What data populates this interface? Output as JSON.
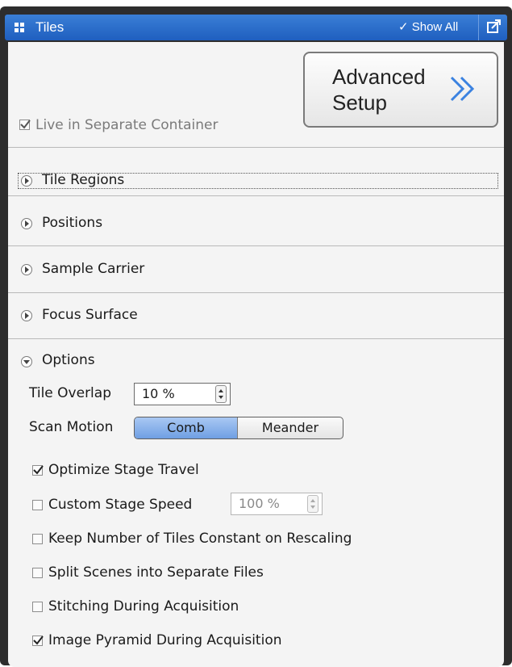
{
  "window": {
    "title": "Tiles",
    "show_all_label": "✓ Show All"
  },
  "advanced_setup": {
    "line1": "Advanced",
    "line2": "Setup"
  },
  "live_separate": {
    "label": "Live in Separate Container",
    "checked": true
  },
  "sections": [
    {
      "label": "Tile Regions",
      "expanded": false,
      "focused": true
    },
    {
      "label": "Positions",
      "expanded": false
    },
    {
      "label": "Sample Carrier",
      "expanded": false
    },
    {
      "label": "Focus Surface",
      "expanded": false
    },
    {
      "label": "Options",
      "expanded": true
    }
  ],
  "options": {
    "tile_overlap": {
      "label": "Tile Overlap",
      "value": "10 %"
    },
    "scan_motion": {
      "label": "Scan Motion",
      "choices": [
        "Comb",
        "Meander"
      ],
      "selected": "Comb"
    },
    "checkboxes": [
      {
        "label": "Optimize Stage Travel",
        "checked": true
      },
      {
        "label": "Custom Stage Speed",
        "checked": false,
        "speed_value": "100 %"
      },
      {
        "label": "Keep Number of Tiles Constant on Rescaling",
        "checked": false
      },
      {
        "label": "Split Scenes into Separate Files",
        "checked": false
      },
      {
        "label": "Stitching During Acquisition",
        "checked": false
      },
      {
        "label": "Image Pyramid During Acquisition",
        "checked": true
      }
    ]
  },
  "colors": {
    "title_bar": "#2b6fd0",
    "selected_segment": "#7fa9e6",
    "panel_bg": "#f4f4f4",
    "frame": "#2d2d2d"
  }
}
